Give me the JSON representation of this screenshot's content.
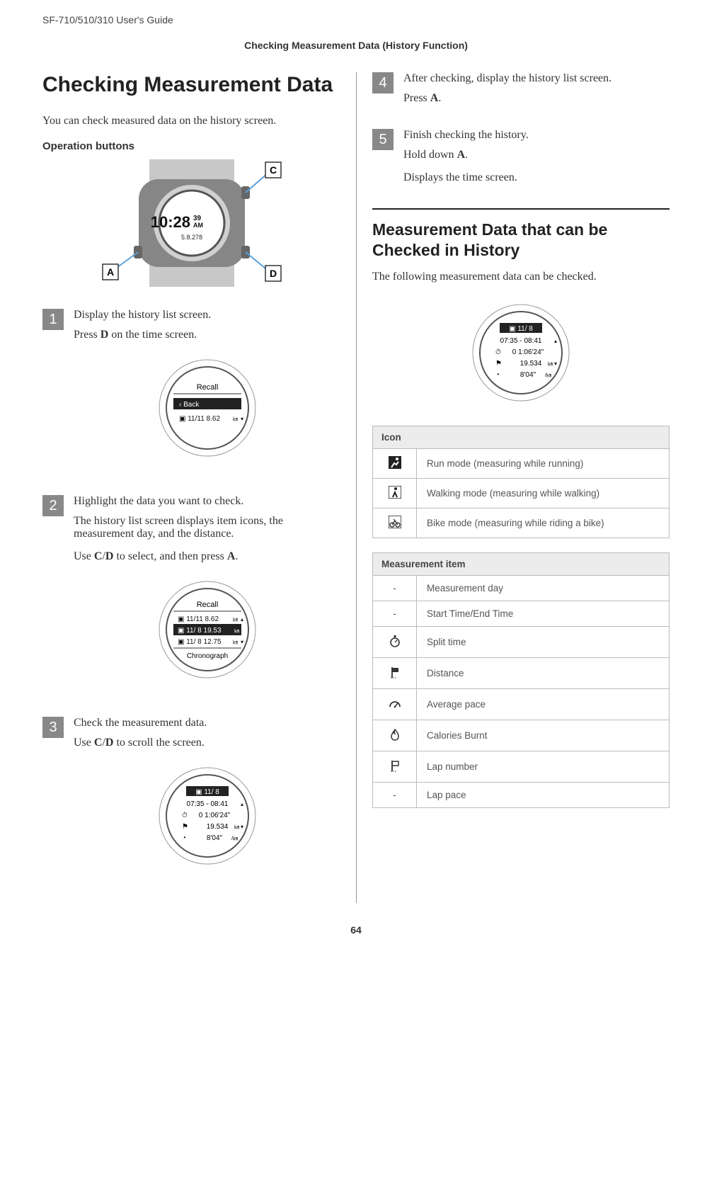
{
  "header": {
    "doc_title": "SF-710/510/310     User's Guide",
    "subheader": "Checking Measurement Data (History Function)"
  },
  "main": {
    "title": "Checking Measurement Data",
    "intro": "You can check measured data on the history screen.",
    "op_buttons_label": "Operation buttons"
  },
  "watch_main": {
    "time1": "10:28",
    "time2_top": "39",
    "time2_bottom": "AM",
    "date": "5.8.278",
    "label_A": "A",
    "label_C": "C",
    "label_D": "D"
  },
  "steps": [
    {
      "num": "1",
      "title": "Display the history list screen.",
      "subs": [
        "Press D on the time screen."
      ],
      "screen": {
        "type": "recall1",
        "header": "Recall",
        "rows": [
          {
            "left": "‹ Back",
            "right": ""
          },
          {
            "left": "11/11",
            "right": "8.62"
          }
        ]
      }
    },
    {
      "num": "2",
      "title": "Highlight the data you want to check.",
      "subs": [
        "The history list screen displays item icons, the measurement day, and the distance.",
        "Use C/D to select, and then press A."
      ],
      "screen": {
        "type": "recall2",
        "header": "Recall",
        "rows": [
          {
            "left": "11/11",
            "right": "8.62"
          },
          {
            "left": "11/ 8",
            "right": "19.53",
            "hl": true
          },
          {
            "left": "11/ 8",
            "right": "12.75"
          }
        ],
        "footer": "Chronograph"
      }
    },
    {
      "num": "3",
      "title": "Check the measurement data.",
      "subs": [
        "Use C/D to scroll the screen."
      ],
      "screen": {
        "type": "detail",
        "rows": [
          "11/ 8",
          "07:35 - 08:41",
          "0 1:06'24\"",
          "19.534km",
          "8'04\"/km"
        ]
      }
    },
    {
      "num": "4",
      "title": "After checking, display the history list screen.",
      "subs": [
        "Press A."
      ]
    },
    {
      "num": "5",
      "title": "Finish checking the history.",
      "subs": [
        "Hold down A.",
        "Displays the time screen."
      ]
    }
  ],
  "section2": {
    "title": "Measurement Data that can be Checked in History",
    "intro": "The following measurement data can be checked.",
    "screen": {
      "type": "detail",
      "rows": [
        "11/ 8",
        "07:35 - 08:41",
        "0 1:06'24\"",
        "19.534km",
        "8'04\"/km"
      ]
    }
  },
  "icon_table": {
    "header": "Icon",
    "rows": [
      {
        "icon": "run-mode-icon",
        "label": "Run mode (measuring while running)"
      },
      {
        "icon": "walk-mode-icon",
        "label": "Walking mode (measuring while walking)"
      },
      {
        "icon": "bike-mode-icon",
        "label": "Bike mode (measuring while riding a bike)"
      }
    ]
  },
  "measurement_table": {
    "header": "Measurement item",
    "rows": [
      {
        "icon": "-",
        "label": "Measurement day"
      },
      {
        "icon": "-",
        "label": "Start Time/End Time"
      },
      {
        "icon": "stopwatch-icon",
        "label": "Split time"
      },
      {
        "icon": "flag-icon",
        "label": "Distance"
      },
      {
        "icon": "gauge-icon",
        "label": "Average pace"
      },
      {
        "icon": "flame-icon",
        "label": "Calories Burnt"
      },
      {
        "icon": "lap-flag-icon",
        "label": "Lap number"
      },
      {
        "icon": "-",
        "label": "Lap pace"
      }
    ]
  },
  "page_num": "64"
}
